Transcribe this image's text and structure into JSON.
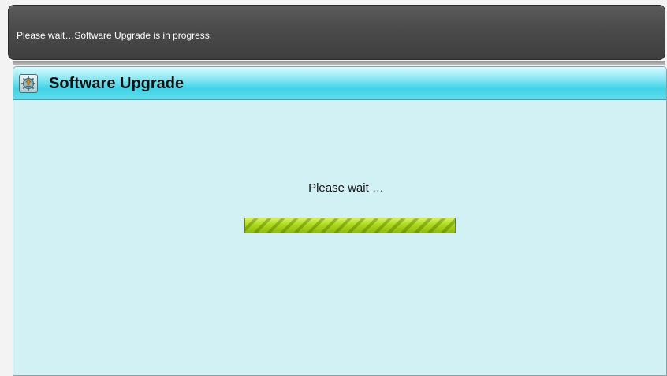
{
  "message_bar": {
    "text": "Please wait…Software Upgrade is in progress."
  },
  "dialog": {
    "title": "Software Upgrade",
    "icon": "software-upgrade-icon",
    "status_text": "Please wait …",
    "progress": {
      "value_percent": 100
    }
  },
  "colors": {
    "message_bar_bg": "#4a4a4a",
    "header_accent": "#3fd3e6",
    "panel_bg": "#d2f1f5",
    "progress_fill": "#a8d61a"
  }
}
